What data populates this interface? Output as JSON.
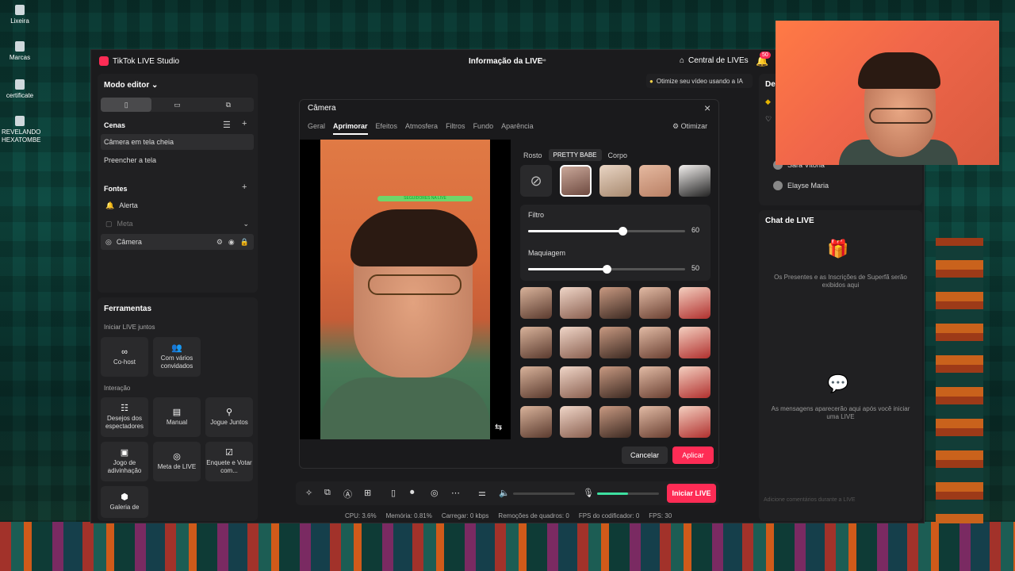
{
  "desktop": {
    "icons": [
      "Lixeira",
      "Marcas",
      "certificate",
      "REVELANDO HEXATOMBE"
    ]
  },
  "titlebar": {
    "app_title": "TikTok LIVE Studio",
    "center_title": "Informação da LIVE",
    "central_label": "Central de LIVEs",
    "badge": "50"
  },
  "hint": "Otimize seu vídeo usando a IA",
  "editor": {
    "mode_label": "Modo editor",
    "cenas_label": "Cenas",
    "scenes": [
      "Câmera em tela cheia",
      "Preencher a tela"
    ],
    "fontes_label": "Fontes",
    "sources": [
      "Alerta",
      "Meta",
      "Câmera"
    ]
  },
  "tools": {
    "header": "Ferramentas",
    "group1": "Iniciar LIVE juntos",
    "cohost": "Co-host",
    "multi": "Com vários convidados",
    "group2": "Interação",
    "desejos": "Desejos dos espectadores",
    "manual": "Manual",
    "jogue": "Jogue Juntos",
    "jogo": "Jogo de adivinhação",
    "meta": "Meta de LIVE",
    "enquete": "Enquete e Votar com...",
    "galeria": "Galeria de"
  },
  "modal": {
    "title": "Câmera",
    "tabs": [
      "Geral",
      "Aprimorar",
      "Efeitos",
      "Atmosfera",
      "Filtros",
      "Fundo",
      "Aparência"
    ],
    "active_tab": "Aprimorar",
    "otimizar": "Otimizar",
    "sub_tabs": [
      "Rosto",
      "PRETTY BABE",
      "Corpo"
    ],
    "active_sub": "PRETTY BABE",
    "overlay_text": "SEGUIDORES NA LIVE",
    "filtro_label": "Filtro",
    "filtro_value": 60,
    "makeup_label": "Maquiagem",
    "makeup_value": 50,
    "cancel": "Cancelar",
    "apply": "Aplicar"
  },
  "bottombar": {
    "go_live": "Iniciar LIVE",
    "mic_level": 0.5
  },
  "stats": {
    "cpu": "CPU: 3.6%",
    "mem": "Memória: 0.81%",
    "load": "Carregar: 0 kbps",
    "drops": "Remoções de quadros: 0",
    "fps_enc": "FPS do codificador: 0",
    "fps": "FPS: 30"
  },
  "right": {
    "partial_head": "De",
    "viewers": [
      "Sara Vitória",
      "Elayse Maria"
    ],
    "chat_title": "Chat de LIVE",
    "gifts_text": "Os Presentes e as Inscrições de Superfã serão exibidos aqui",
    "messages_text": "As mensagens aparecerão aqui após você iniciar uma LIVE",
    "chat_placeholder": "Adicione comentários durante a LIVE"
  }
}
